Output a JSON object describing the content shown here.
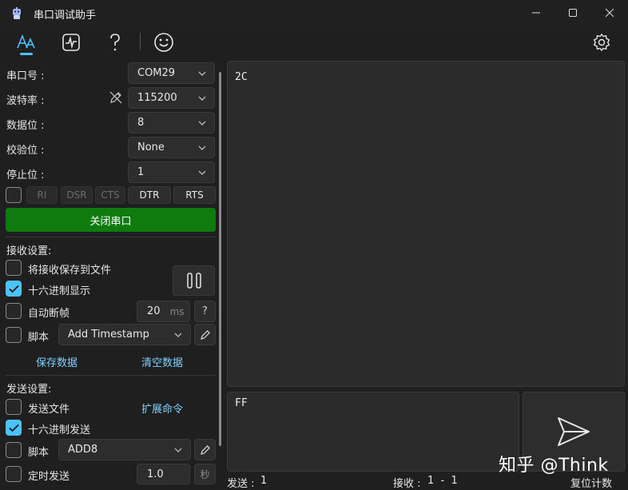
{
  "app": {
    "title": "串口调试助手"
  },
  "window": {
    "minimize_icon": "minimize-icon",
    "maximize_icon": "maximize-icon",
    "close_icon": "close-icon"
  },
  "toolbar": {
    "items": [
      "font-icon",
      "waveform-icon",
      "help-icon",
      "smiley-icon"
    ],
    "settings_icon": "gear-icon"
  },
  "serial": {
    "port_label": "串口号 :",
    "port_value": "COM29",
    "baud_label": "波特率 :",
    "baud_value": "115200",
    "databits_label": "数据位 :",
    "databits_value": "8",
    "parity_label": "校验位 :",
    "parity_value": "None",
    "stopbits_label": "停止位 :",
    "stopbits_value": "1",
    "signals": [
      "RI",
      "DSR",
      "CTS",
      "DTR",
      "RTS"
    ],
    "open_button": "关闭串口",
    "open_button_color": "#0f7b0f"
  },
  "receive": {
    "section_title": "接收设置:",
    "save_to_file": "将接收保存到文件",
    "save_to_file_checked": false,
    "hex_display": "十六进制显示",
    "hex_display_checked": true,
    "auto_frame": "自动断帧",
    "auto_frame_checked": false,
    "frame_value": "20",
    "frame_unit": "ms",
    "frame_help": "?",
    "script_label": "脚本",
    "script_checked": false,
    "script_value": "Add Timestamp",
    "save_data": "保存数据",
    "clear_data": "清空数据"
  },
  "send": {
    "section_title": "发送设置:",
    "send_file": "发送文件",
    "send_file_checked": false,
    "extend_cmd": "扩展命令",
    "hex_send": "十六进制发送",
    "hex_send_checked": true,
    "script_label": "脚本",
    "script_checked": false,
    "script_value": "ADD8",
    "timed_send": "定时发送",
    "timed_send_checked": false,
    "timed_value": "1.0",
    "timed_unit": "秒"
  },
  "rx_content": "2C",
  "tx_content": "FF",
  "status": {
    "sent_label": "发送 :",
    "sent_count": "1",
    "recv_label": "接收 :",
    "recv_count": "1  -  1",
    "reset": "复位计数"
  },
  "watermark": "知乎 @Think",
  "colors": {
    "accent": "#4cc2ff",
    "link": "#7fd0ff",
    "open_green": "#0f7b0f"
  }
}
